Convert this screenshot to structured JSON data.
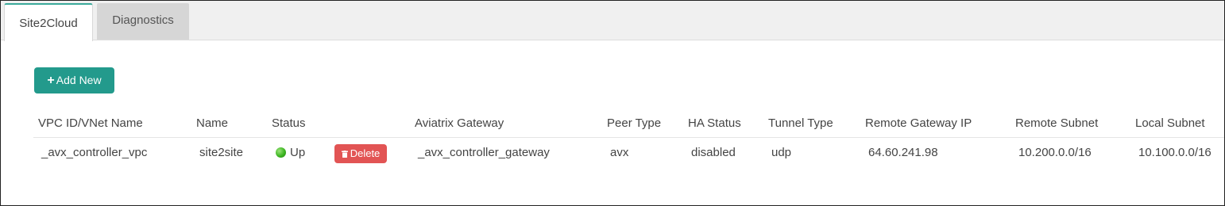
{
  "tabs": [
    {
      "label": "Site2Cloud",
      "active": true
    },
    {
      "label": "Diagnostics",
      "active": false
    }
  ],
  "toolbar": {
    "add_label": "Add New"
  },
  "table": {
    "columns": [
      "VPC ID/VNet Name",
      "Name",
      "Status",
      "Aviatrix Gateway",
      "Peer Type",
      "HA Status",
      "Tunnel Type",
      "Remote Gateway IP",
      "Remote Subnet",
      "Local Subnet"
    ],
    "rows": [
      {
        "vpc": "_avx_controller_vpc",
        "name": "site2site",
        "status": "Up",
        "action": "Delete",
        "gateway": "_avx_controller_gateway",
        "peer_type": "avx",
        "ha_status": "disabled",
        "tunnel_type": "udp",
        "remote_gateway_ip": "64.60.241.98",
        "remote_subnet": "10.200.0.0/16",
        "local_subnet": "10.100.0.0/16"
      }
    ]
  },
  "colors": {
    "accent": "#239a8c",
    "danger": "#e25454",
    "status_up": "#3cb521",
    "tab_active_border": "#3aa99a"
  },
  "icons": {
    "add": "plus-icon",
    "delete": "trash-icon",
    "status": "status-dot-icon"
  }
}
